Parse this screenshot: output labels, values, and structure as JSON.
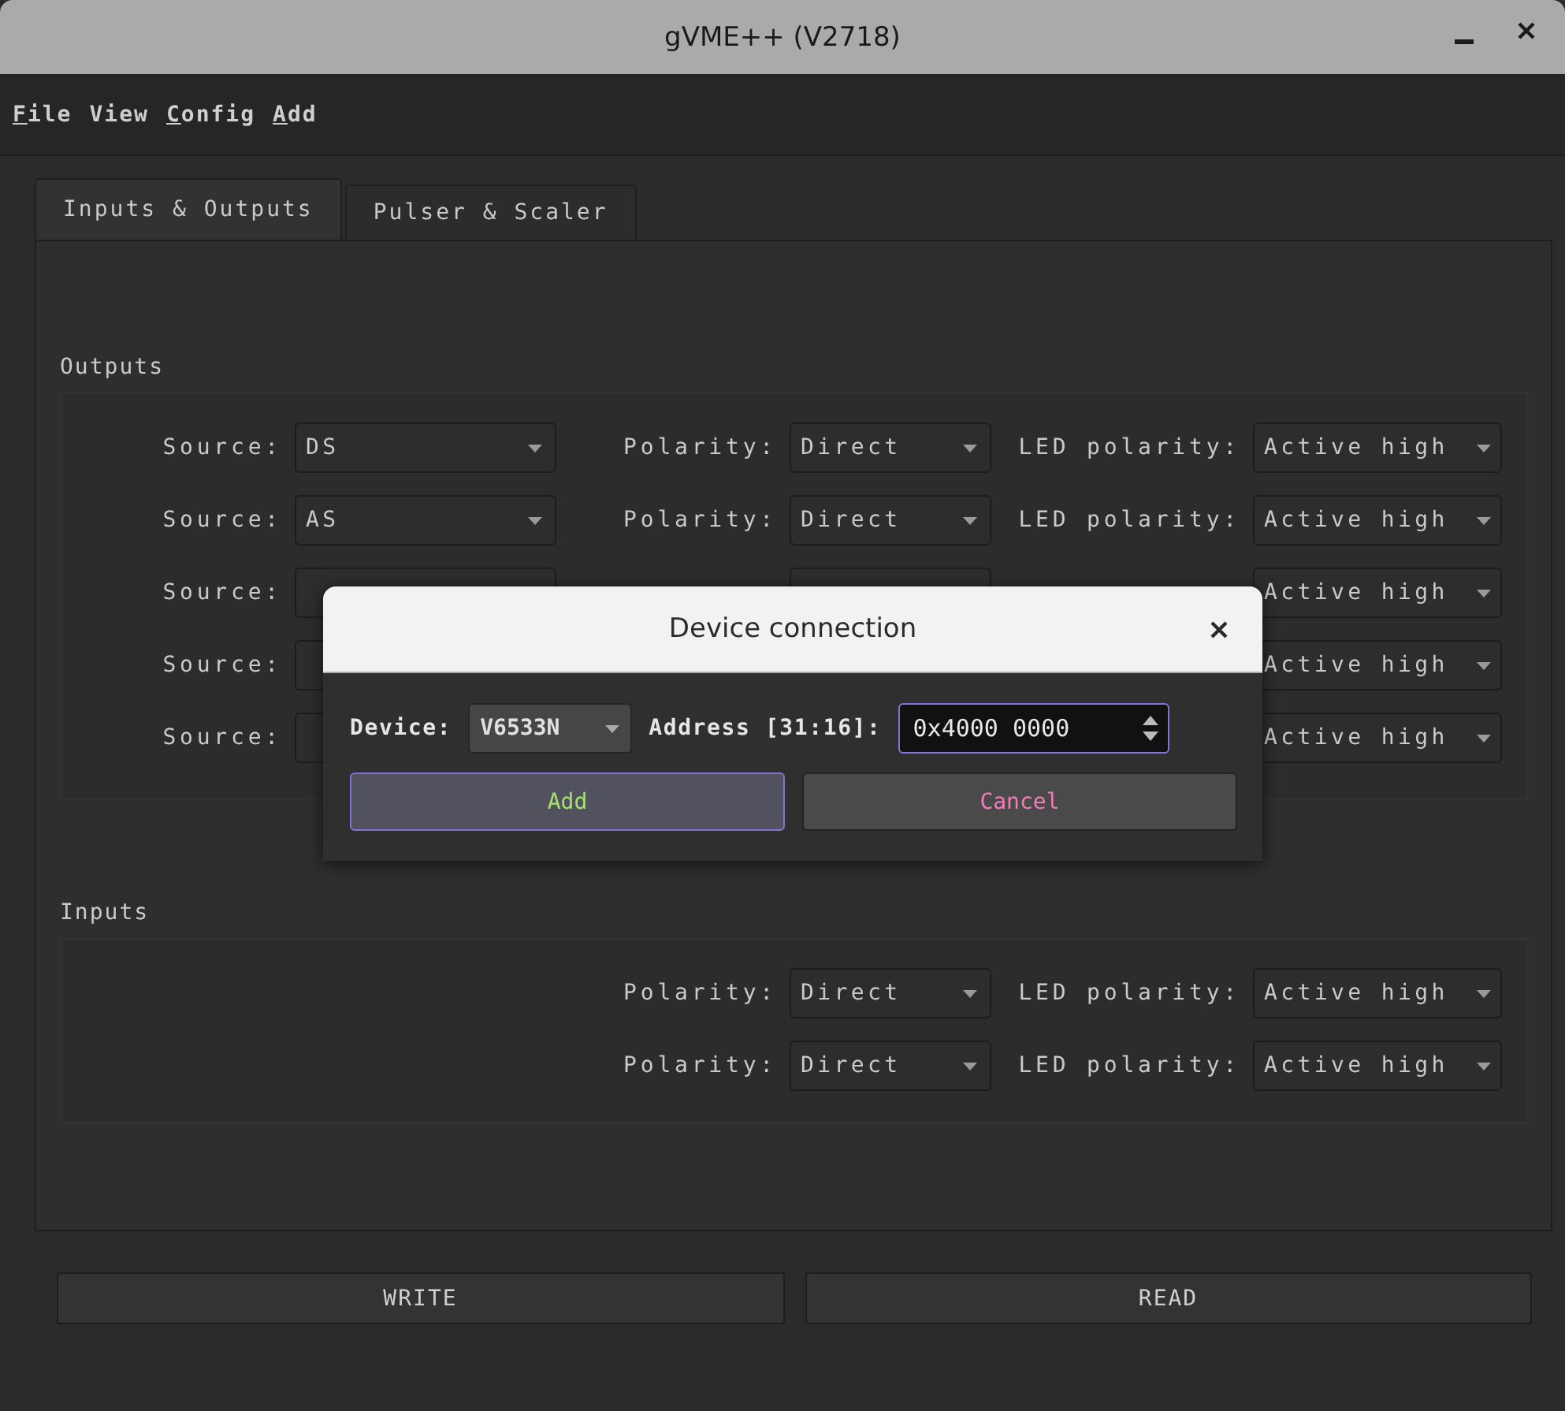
{
  "window": {
    "title": "gVME++ (V2718)"
  },
  "menu": [
    {
      "label": "File",
      "mnemonic": true
    },
    {
      "label": "View",
      "mnemonic": false
    },
    {
      "label": "Config",
      "mnemonic": true
    },
    {
      "label": "Add",
      "mnemonic": true
    }
  ],
  "tabs": [
    {
      "label": "Inputs & Outputs",
      "selected": true
    },
    {
      "label": "Pulser & Scaler",
      "selected": false
    }
  ],
  "outputs": {
    "title": "Outputs",
    "rows": [
      {
        "source_label": "Source:",
        "source": "DS",
        "polarity_label": "Polarity:",
        "polarity": "Direct",
        "led_label": "LED polarity:",
        "led": "Active high"
      },
      {
        "source_label": "Source:",
        "source": "AS",
        "polarity_label": "Polarity:",
        "polarity": "Direct",
        "led_label": "LED polarity:",
        "led": "Active high"
      },
      {
        "source_label": "Source:",
        "led": "Active high"
      },
      {
        "source_label": "Source:",
        "led": "Active high"
      },
      {
        "source_label": "Source:",
        "led": "Active high"
      }
    ]
  },
  "inputs": {
    "title": "Inputs",
    "rows": [
      {
        "polarity_label": "Polarity:",
        "polarity": "Direct",
        "led_label": "LED polarity:",
        "led": "Active high"
      },
      {
        "polarity_label": "Polarity:",
        "polarity": "Direct",
        "led_label": "LED polarity:",
        "led": "Active high"
      }
    ]
  },
  "buttons": [
    "WRITE",
    "READ"
  ],
  "dialog": {
    "title": "Device connection",
    "device_label": "Device:",
    "device": "V6533N",
    "address_label": "Address [31:16]:",
    "address": "0x4000 0000",
    "buttons": [
      {
        "label": "Add",
        "kind": "primary"
      },
      {
        "label": "Cancel",
        "kind": "cancel"
      }
    ]
  }
}
